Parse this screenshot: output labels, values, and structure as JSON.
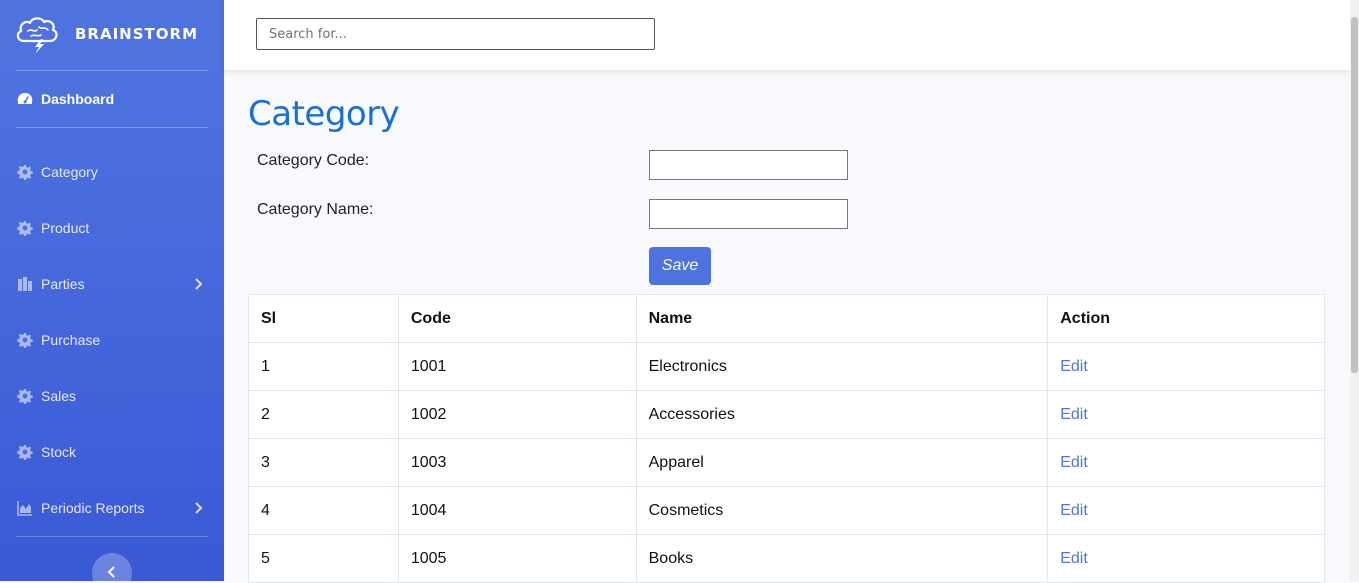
{
  "brand": {
    "name": "BRAINSTORM",
    "logo_icon": "brain-cloud-icon"
  },
  "sidebar": {
    "items": [
      {
        "label": "Dashboard",
        "icon": "tachometer-icon",
        "active": true
      },
      {
        "label": "Category",
        "icon": "gear-icon"
      },
      {
        "label": "Product",
        "icon": "gear-icon"
      },
      {
        "label": "Parties",
        "icon": "building-icon",
        "has_submenu": true
      },
      {
        "label": "Purchase",
        "icon": "gear-icon"
      },
      {
        "label": "Sales",
        "icon": "gear-icon"
      },
      {
        "label": "Stock",
        "icon": "gear-icon"
      },
      {
        "label": "Periodic Reports",
        "icon": "chart-area-icon",
        "has_submenu": true
      }
    ]
  },
  "topbar": {
    "search_placeholder": "Search for..."
  },
  "page": {
    "title": "Category",
    "form": {
      "code_label": "Category Code:",
      "code_value": "",
      "name_label": "Category Name:",
      "name_value": "",
      "save_label": "Save"
    },
    "table": {
      "headers": [
        "Sl",
        "Code",
        "Name",
        "Action"
      ],
      "rows": [
        {
          "sl": "1",
          "code": "1001",
          "name": "Electronics",
          "action": "Edit"
        },
        {
          "sl": "2",
          "code": "1002",
          "name": "Accessories",
          "action": "Edit"
        },
        {
          "sl": "3",
          "code": "1003",
          "name": "Apparel",
          "action": "Edit"
        },
        {
          "sl": "4",
          "code": "1004",
          "name": "Cosmetics",
          "action": "Edit"
        },
        {
          "sl": "5",
          "code": "1005",
          "name": "Books",
          "action": "Edit"
        }
      ]
    }
  },
  "colors": {
    "sidebar": "#4e73df",
    "title": "#1a6ed8",
    "link": "#4e73df"
  }
}
